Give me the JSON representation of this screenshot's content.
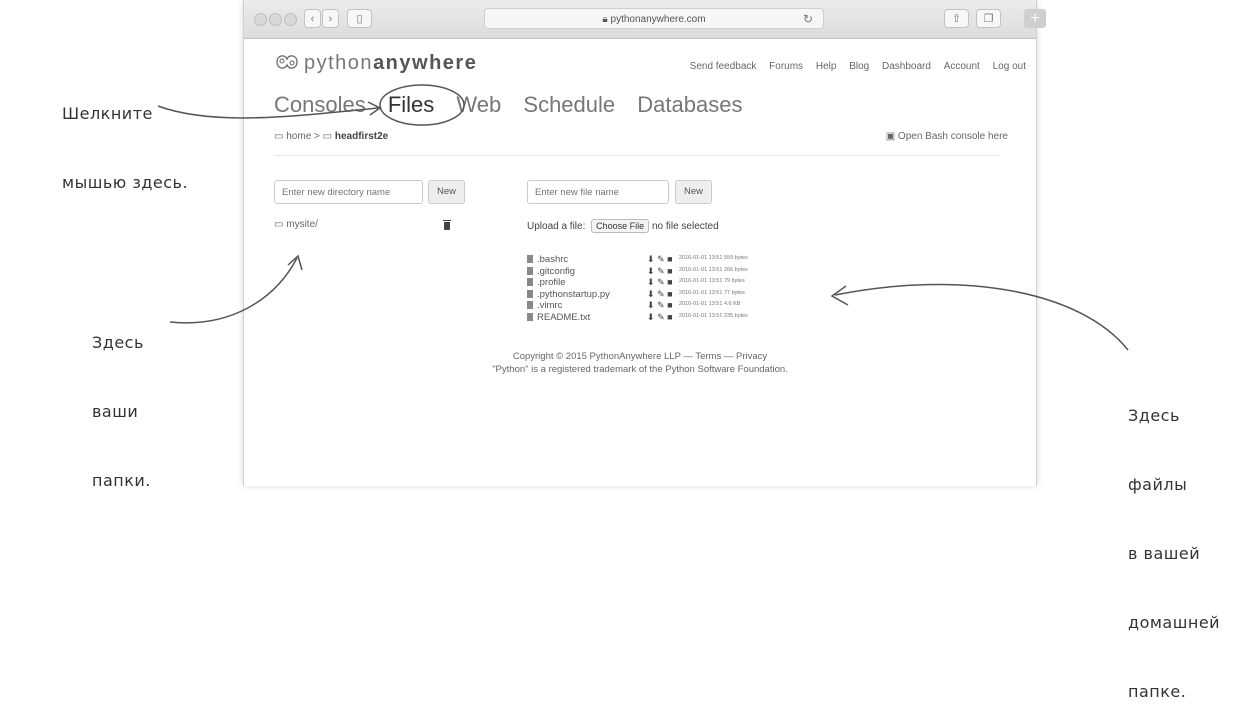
{
  "annotations": {
    "click_here": [
      "Шелкните",
      "мышью здесь."
    ],
    "folders_here": [
      "Здесь",
      "ваши",
      "папки."
    ],
    "files_here": [
      "Здесь",
      "файлы",
      "в вашей",
      "домашней",
      "папке."
    ]
  },
  "browser": {
    "url": "pythonanywhere.com"
  },
  "site": {
    "logo_light": "python",
    "logo_bold": "anywhere",
    "top_links": [
      "Send feedback",
      "Forums",
      "Help",
      "Blog",
      "Dashboard",
      "Account",
      "Log out"
    ],
    "nav_tabs": [
      "Consoles",
      "Files",
      "Web",
      "Schedule",
      "Databases"
    ],
    "active_tab": "Files",
    "breadcrumb_home": "home",
    "breadcrumb_sep": ">",
    "breadcrumb_current": "headfirst2e",
    "open_bash": "Open Bash console here"
  },
  "dirs": {
    "input_placeholder": "Enter new directory name",
    "new_button": "New",
    "items": [
      "mysite/"
    ]
  },
  "files": {
    "input_placeholder": "Enter new file name",
    "new_button": "New",
    "upload_label": "Upload a file:",
    "choose_button": "Choose File",
    "no_file": "no file selected",
    "items": [
      {
        "name": ".bashrc",
        "meta": "2016-01-01 13:51 559 bytes"
      },
      {
        "name": ".gitconfig",
        "meta": "2016-01-01 13:51 266 bytes"
      },
      {
        "name": ".profile",
        "meta": "2016-01-01 13:51 79 bytes"
      },
      {
        "name": ".pythonstartup.py",
        "meta": "2016-01-01 13:51 77 bytes"
      },
      {
        "name": ".vimrc",
        "meta": "2016-01-01 13:51 4.6 KB"
      },
      {
        "name": "README.txt",
        "meta": "2016-01-01 13:51 235 bytes"
      }
    ]
  },
  "footer": {
    "line1": "Copyright © 2015 PythonAnywhere LLP — Terms — Privacy",
    "line2": "\"Python\" is a registered trademark of the Python Software Foundation."
  }
}
